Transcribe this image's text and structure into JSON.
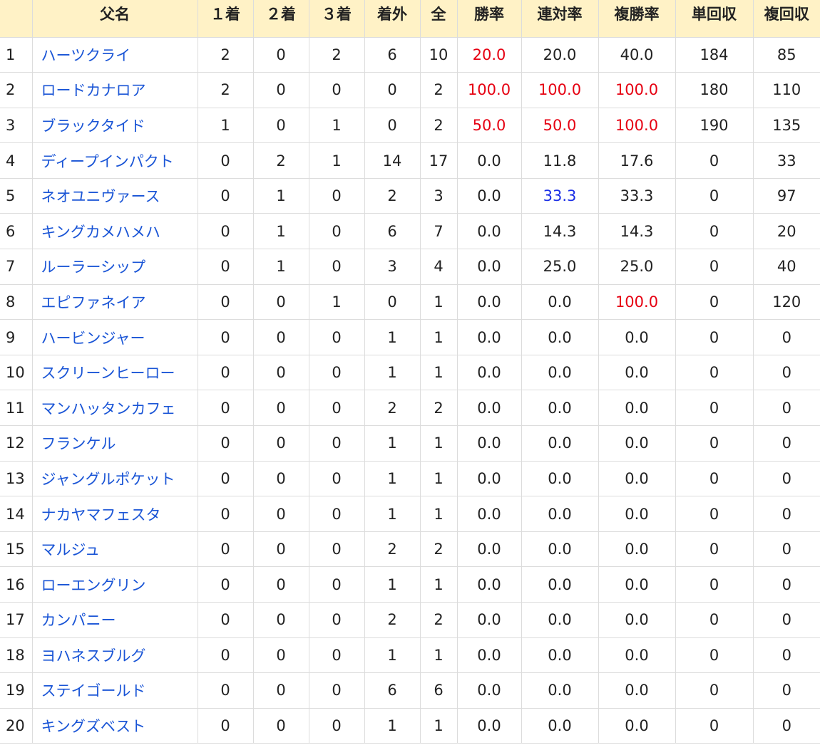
{
  "headers": [
    "",
    "父名",
    "１着",
    "２着",
    "３着",
    "着外",
    "全",
    "勝率",
    "連対率",
    "複勝率",
    "単回収",
    "複回収"
  ],
  "rows": [
    {
      "rank": "1",
      "name": "ハーツクライ",
      "c1": "2",
      "c2": "0",
      "c3": "2",
      "out": "6",
      "total": "10",
      "win": "20.0",
      "ren": "20.0",
      "fuku": "40.0",
      "tan_ret": "184",
      "fuku_ret": "85",
      "hl": {
        "win": "red"
      }
    },
    {
      "rank": "2",
      "name": "ロードカナロア",
      "c1": "2",
      "c2": "0",
      "c3": "0",
      "out": "0",
      "total": "2",
      "win": "100.0",
      "ren": "100.0",
      "fuku": "100.0",
      "tan_ret": "180",
      "fuku_ret": "110",
      "hl": {
        "win": "red",
        "ren": "red",
        "fuku": "red"
      }
    },
    {
      "rank": "3",
      "name": "ブラックタイド",
      "c1": "1",
      "c2": "0",
      "c3": "1",
      "out": "0",
      "total": "2",
      "win": "50.0",
      "ren": "50.0",
      "fuku": "100.0",
      "tan_ret": "190",
      "fuku_ret": "135",
      "hl": {
        "win": "red",
        "ren": "red",
        "fuku": "red"
      }
    },
    {
      "rank": "4",
      "name": "ディープインパクト",
      "c1": "0",
      "c2": "2",
      "c3": "1",
      "out": "14",
      "total": "17",
      "win": "0.0",
      "ren": "11.8",
      "fuku": "17.6",
      "tan_ret": "0",
      "fuku_ret": "33",
      "hl": {}
    },
    {
      "rank": "5",
      "name": "ネオユニヴァース",
      "c1": "0",
      "c2": "1",
      "c3": "0",
      "out": "2",
      "total": "3",
      "win": "0.0",
      "ren": "33.3",
      "fuku": "33.3",
      "tan_ret": "0",
      "fuku_ret": "97",
      "hl": {
        "ren": "blue"
      }
    },
    {
      "rank": "6",
      "name": "キングカメハメハ",
      "c1": "0",
      "c2": "1",
      "c3": "0",
      "out": "6",
      "total": "7",
      "win": "0.0",
      "ren": "14.3",
      "fuku": "14.3",
      "tan_ret": "0",
      "fuku_ret": "20",
      "hl": {}
    },
    {
      "rank": "7",
      "name": "ルーラーシップ",
      "c1": "0",
      "c2": "1",
      "c3": "0",
      "out": "3",
      "total": "4",
      "win": "0.0",
      "ren": "25.0",
      "fuku": "25.0",
      "tan_ret": "0",
      "fuku_ret": "40",
      "hl": {}
    },
    {
      "rank": "8",
      "name": "エピファネイア",
      "c1": "0",
      "c2": "0",
      "c3": "1",
      "out": "0",
      "total": "1",
      "win": "0.0",
      "ren": "0.0",
      "fuku": "100.0",
      "tan_ret": "0",
      "fuku_ret": "120",
      "hl": {
        "fuku": "red"
      }
    },
    {
      "rank": "9",
      "name": "ハービンジャー",
      "c1": "0",
      "c2": "0",
      "c3": "0",
      "out": "1",
      "total": "1",
      "win": "0.0",
      "ren": "0.0",
      "fuku": "0.0",
      "tan_ret": "0",
      "fuku_ret": "0",
      "hl": {}
    },
    {
      "rank": "10",
      "name": "スクリーンヒーロー",
      "c1": "0",
      "c2": "0",
      "c3": "0",
      "out": "1",
      "total": "1",
      "win": "0.0",
      "ren": "0.0",
      "fuku": "0.0",
      "tan_ret": "0",
      "fuku_ret": "0",
      "hl": {}
    },
    {
      "rank": "11",
      "name": "マンハッタンカフェ",
      "c1": "0",
      "c2": "0",
      "c3": "0",
      "out": "2",
      "total": "2",
      "win": "0.0",
      "ren": "0.0",
      "fuku": "0.0",
      "tan_ret": "0",
      "fuku_ret": "0",
      "hl": {}
    },
    {
      "rank": "12",
      "name": "フランケル",
      "c1": "0",
      "c2": "0",
      "c3": "0",
      "out": "1",
      "total": "1",
      "win": "0.0",
      "ren": "0.0",
      "fuku": "0.0",
      "tan_ret": "0",
      "fuku_ret": "0",
      "hl": {}
    },
    {
      "rank": "13",
      "name": "ジャングルポケット",
      "c1": "0",
      "c2": "0",
      "c3": "0",
      "out": "1",
      "total": "1",
      "win": "0.0",
      "ren": "0.0",
      "fuku": "0.0",
      "tan_ret": "0",
      "fuku_ret": "0",
      "hl": {}
    },
    {
      "rank": "14",
      "name": "ナカヤマフェスタ",
      "c1": "0",
      "c2": "0",
      "c3": "0",
      "out": "1",
      "total": "1",
      "win": "0.0",
      "ren": "0.0",
      "fuku": "0.0",
      "tan_ret": "0",
      "fuku_ret": "0",
      "hl": {}
    },
    {
      "rank": "15",
      "name": "マルジュ",
      "c1": "0",
      "c2": "0",
      "c3": "0",
      "out": "2",
      "total": "2",
      "win": "0.0",
      "ren": "0.0",
      "fuku": "0.0",
      "tan_ret": "0",
      "fuku_ret": "0",
      "hl": {}
    },
    {
      "rank": "16",
      "name": "ローエングリン",
      "c1": "0",
      "c2": "0",
      "c3": "0",
      "out": "1",
      "total": "1",
      "win": "0.0",
      "ren": "0.0",
      "fuku": "0.0",
      "tan_ret": "0",
      "fuku_ret": "0",
      "hl": {}
    },
    {
      "rank": "17",
      "name": "カンパニー",
      "c1": "0",
      "c2": "0",
      "c3": "0",
      "out": "2",
      "total": "2",
      "win": "0.0",
      "ren": "0.0",
      "fuku": "0.0",
      "tan_ret": "0",
      "fuku_ret": "0",
      "hl": {}
    },
    {
      "rank": "18",
      "name": "ヨハネスブルグ",
      "c1": "0",
      "c2": "0",
      "c3": "0",
      "out": "1",
      "total": "1",
      "win": "0.0",
      "ren": "0.0",
      "fuku": "0.0",
      "tan_ret": "0",
      "fuku_ret": "0",
      "hl": {}
    },
    {
      "rank": "19",
      "name": "ステイゴールド",
      "c1": "0",
      "c2": "0",
      "c3": "0",
      "out": "6",
      "total": "6",
      "win": "0.0",
      "ren": "0.0",
      "fuku": "0.0",
      "tan_ret": "0",
      "fuku_ret": "0",
      "hl": {}
    },
    {
      "rank": "20",
      "name": "キングズベスト",
      "c1": "0",
      "c2": "0",
      "c3": "0",
      "out": "1",
      "total": "1",
      "win": "0.0",
      "ren": "0.0",
      "fuku": "0.0",
      "tan_ret": "0",
      "fuku_ret": "0",
      "hl": {}
    }
  ],
  "colors": {
    "header_bg": "#fff2c6",
    "link": "#1a55d6",
    "highlight_red": "#e60012",
    "highlight_blue": "#1a2ee6",
    "grid": "#dcdcdc"
  }
}
